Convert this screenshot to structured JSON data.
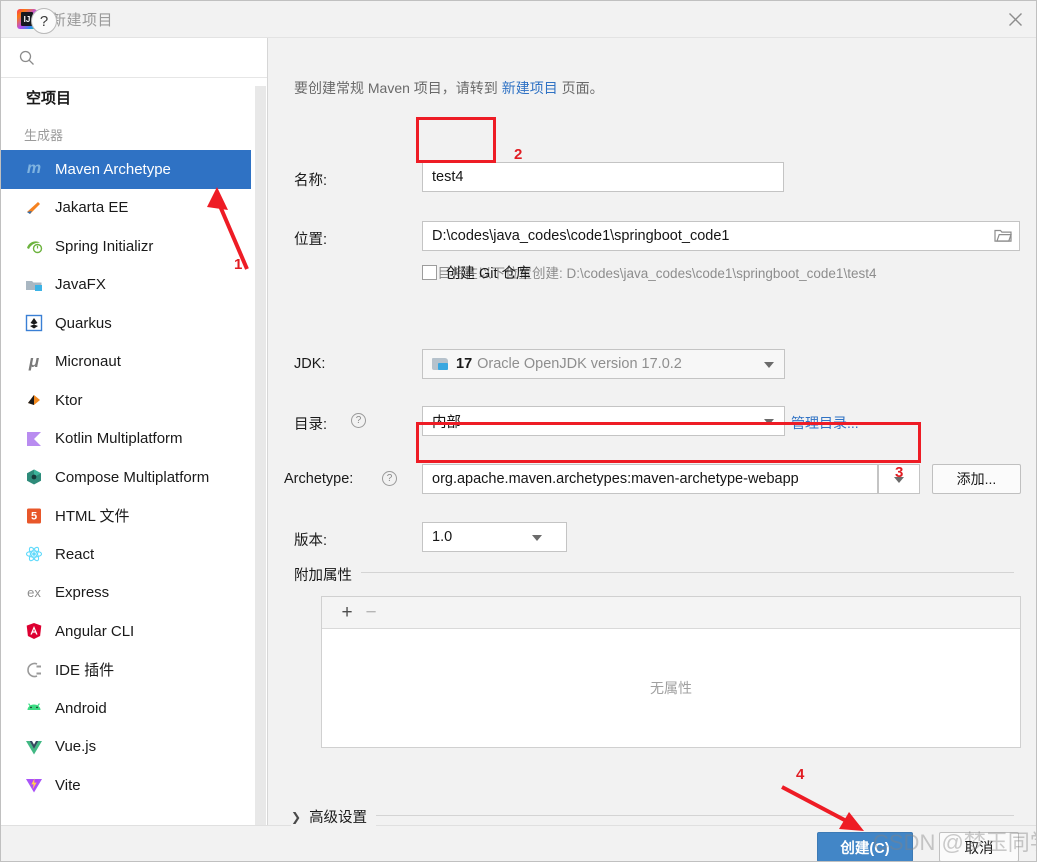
{
  "window": {
    "title": "新建项目",
    "app_icon": "intellij-idea-icon",
    "close_icon": "close-icon"
  },
  "sidebar": {
    "search": {
      "value": "",
      "placeholder": "",
      "icon": "search-icon"
    },
    "top_items": [
      {
        "label": "空项目",
        "name": "empty-project"
      }
    ],
    "section_label": "生成器",
    "generators": [
      {
        "label": "Maven Archetype",
        "icon": "maven-icon",
        "selected": true
      },
      {
        "label": "Jakarta EE",
        "icon": "jakarta-ee-icon",
        "selected": false
      },
      {
        "label": "Spring Initializr",
        "icon": "spring-icon",
        "selected": false
      },
      {
        "label": "JavaFX",
        "icon": "javafx-icon",
        "selected": false
      },
      {
        "label": "Quarkus",
        "icon": "quarkus-icon",
        "selected": false
      },
      {
        "label": "Micronaut",
        "icon": "micronaut-icon",
        "selected": false
      },
      {
        "label": "Ktor",
        "icon": "ktor-icon",
        "selected": false
      },
      {
        "label": "Kotlin Multiplatform",
        "icon": "kotlin-icon",
        "selected": false
      },
      {
        "label": "Compose Multiplatform",
        "icon": "compose-icon",
        "selected": false
      },
      {
        "label": "HTML 文件",
        "icon": "html5-icon",
        "selected": false
      },
      {
        "label": "React",
        "icon": "react-icon",
        "selected": false
      },
      {
        "label": "Express",
        "icon": "express-icon",
        "selected": false
      },
      {
        "label": "Angular CLI",
        "icon": "angular-icon",
        "selected": false
      },
      {
        "label": "IDE 插件",
        "icon": "ide-plugin-icon",
        "selected": false
      },
      {
        "label": "Android",
        "icon": "android-icon",
        "selected": false
      },
      {
        "label": "Vue.js",
        "icon": "vuejs-icon",
        "selected": false
      },
      {
        "label": "Vite",
        "icon": "vite-icon",
        "selected": false
      }
    ]
  },
  "main": {
    "hint": {
      "before": "要创建常规 Maven 项目，请转到 ",
      "link": "新建项目",
      "after": " 页面。"
    },
    "name": {
      "label": "名称:",
      "value": "test4"
    },
    "location": {
      "label": "位置:",
      "value": "D:\\codes\\java_codes\\code1\\springboot_code1",
      "browse_icon": "folder-browse-icon"
    },
    "location_note": "项目将在以下位置创建: D:\\codes\\java_codes\\code1\\springboot_code1\\test4",
    "git": {
      "label": "创建 Git 仓库",
      "checked": false
    },
    "jdk": {
      "label": "JDK:",
      "version": "17",
      "value": "Oracle OpenJDK version 17.0.2",
      "icon": "jdk-folder-icon"
    },
    "catalog": {
      "label": "目录:",
      "value": "内部",
      "help_icon": "help-icon",
      "manage_link": "管理目录..."
    },
    "archetype": {
      "label": "Archetype:",
      "value": "org.apache.maven.archetypes:maven-archetype-webapp",
      "help_icon": "help-icon",
      "add_button": "添加..."
    },
    "version": {
      "label": "版本:",
      "value": "1.0"
    },
    "properties": {
      "legend": "附加属性",
      "add_icon": "plus-icon",
      "remove_icon": "minus-icon",
      "empty_text": "无属性"
    },
    "advanced": {
      "label": "高级设置",
      "chevron": "chevron-right-icon",
      "expanded": false
    }
  },
  "footer": {
    "help_button": "?",
    "create_button": "创建(C)",
    "cancel_button": "取消"
  },
  "annotations": {
    "callout_1": "1",
    "callout_2": "2",
    "callout_3": "3",
    "callout_4": "4"
  },
  "watermark": "CSDN @梦玉同学",
  "colors": {
    "accent": "#2f72c4",
    "selection": "#2f72c4",
    "annotation": "#ee1c25",
    "primary_button": "#4286c7",
    "panel_bg": "#f2f2f2",
    "sidebar_bg": "#ffffff"
  }
}
